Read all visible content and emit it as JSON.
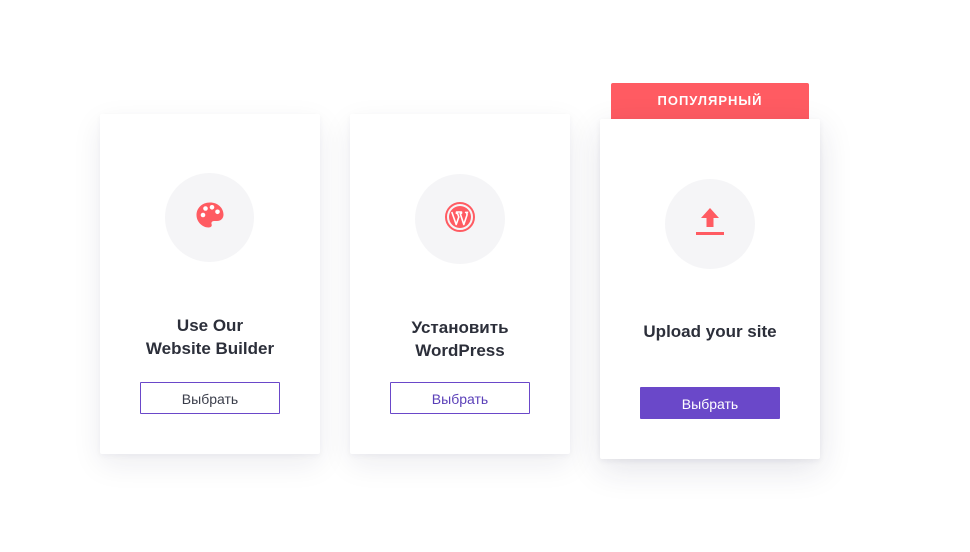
{
  "colors": {
    "accent": "#ff5b62",
    "primary_button": "#6a48c9",
    "icon_circle_bg": "#f5f5f7",
    "title_text": "#2c2f3a"
  },
  "cards": [
    {
      "icon": "palette-icon",
      "title": "Use Our\nWebsite Builder",
      "button_label": "Выбрать",
      "button_style": "outline"
    },
    {
      "icon": "wordpress-icon",
      "title": "Установить\nWordPress",
      "button_label": "Выбрать",
      "button_style": "outline"
    },
    {
      "icon": "upload-icon",
      "title": "Upload your site",
      "button_label": "Выбрать",
      "button_style": "solid",
      "badge": "ПОПУЛЯРНЫЙ"
    }
  ]
}
